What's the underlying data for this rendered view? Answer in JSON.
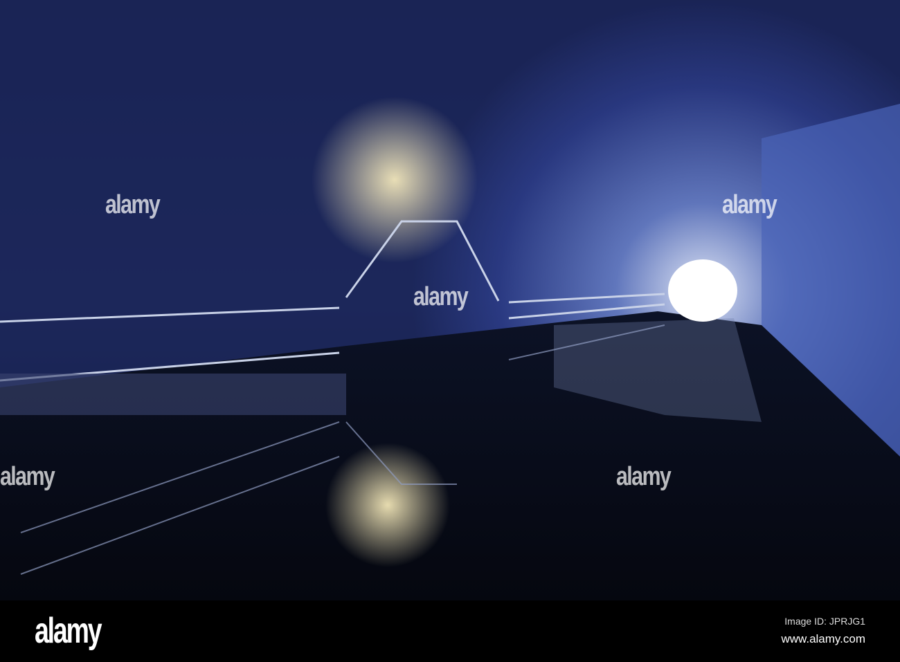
{
  "watermark": {
    "text": "alamy"
  },
  "footer": {
    "logo": "alamy",
    "image_id": "Image ID: JPRJG1",
    "url": "www.alamy.com"
  }
}
